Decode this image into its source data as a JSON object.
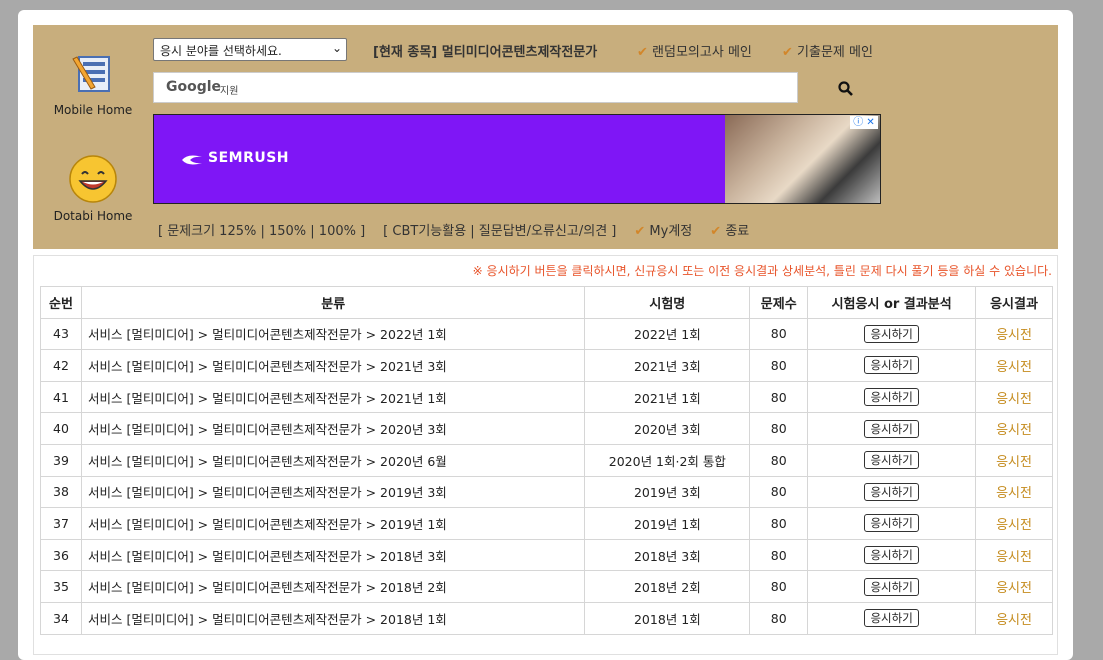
{
  "header": {
    "mobile_home_label": "Mobile Home",
    "dotabi_home_label": "Dotabi Home",
    "select_value": "응시 분야를 선택하세요.",
    "current_subject": "[현재 종목] 멀티미디어콘텐츠제작전문가",
    "link_random": "랜덤모의고사 메인",
    "link_past": "기출문제 메인",
    "search_brand": "Google",
    "search_sub": "지원",
    "ad_brand": "SEMRUSH",
    "ad_close": "ⓘ ✕",
    "font_size_label": "[ 문제크기 125% | 150% | 100% ]",
    "cbt_label": "[ CBT기능활용 | 질문답변/오류신고/의견 ]",
    "my_account": "My계정",
    "exit": "종료"
  },
  "notice": "※ 응시하기 버튼을 클릭하시면, 신규응시 또는 이전 응시결과 상세분석, 틀린 문제 다시 풀기 등을 하실 수 있습니다.",
  "table": {
    "headers": [
      "순번",
      "분류",
      "시험명",
      "문제수",
      "시험응시 or 결과분석",
      "응시결과"
    ],
    "button_label": "응시하기",
    "rows": [
      {
        "no": "43",
        "category": "서비스 [멀티미디어] > 멀티미디어콘텐츠제작전문가 > 2022년 1회",
        "exam": "2022년 1회",
        "count": "80",
        "result": "응시전"
      },
      {
        "no": "42",
        "category": "서비스 [멀티미디어] > 멀티미디어콘텐츠제작전문가 > 2021년 3회",
        "exam": "2021년 3회",
        "count": "80",
        "result": "응시전"
      },
      {
        "no": "41",
        "category": "서비스 [멀티미디어] > 멀티미디어콘텐츠제작전문가 > 2021년 1회",
        "exam": "2021년 1회",
        "count": "80",
        "result": "응시전"
      },
      {
        "no": "40",
        "category": "서비스 [멀티미디어] > 멀티미디어콘텐츠제작전문가 > 2020년 3회",
        "exam": "2020년 3회",
        "count": "80",
        "result": "응시전"
      },
      {
        "no": "39",
        "category": "서비스 [멀티미디어] > 멀티미디어콘텐츠제작전문가 > 2020년 6월",
        "exam": "2020년 1회·2회 통합",
        "count": "80",
        "result": "응시전"
      },
      {
        "no": "38",
        "category": "서비스 [멀티미디어] > 멀티미디어콘텐츠제작전문가 > 2019년 3회",
        "exam": "2019년 3회",
        "count": "80",
        "result": "응시전"
      },
      {
        "no": "37",
        "category": "서비스 [멀티미디어] > 멀티미디어콘텐츠제작전문가 > 2019년 1회",
        "exam": "2019년 1회",
        "count": "80",
        "result": "응시전"
      },
      {
        "no": "36",
        "category": "서비스 [멀티미디어] > 멀티미디어콘텐츠제작전문가 > 2018년 3회",
        "exam": "2018년 3회",
        "count": "80",
        "result": "응시전"
      },
      {
        "no": "35",
        "category": "서비스 [멀티미디어] > 멀티미디어콘텐츠제작전문가 > 2018년 2회",
        "exam": "2018년 2회",
        "count": "80",
        "result": "응시전"
      },
      {
        "no": "34",
        "category": "서비스 [멀티미디어] > 멀티미디어콘텐츠제작전문가 > 2018년 1회",
        "exam": "2018년 1회",
        "count": "80",
        "result": "응시전"
      }
    ]
  }
}
